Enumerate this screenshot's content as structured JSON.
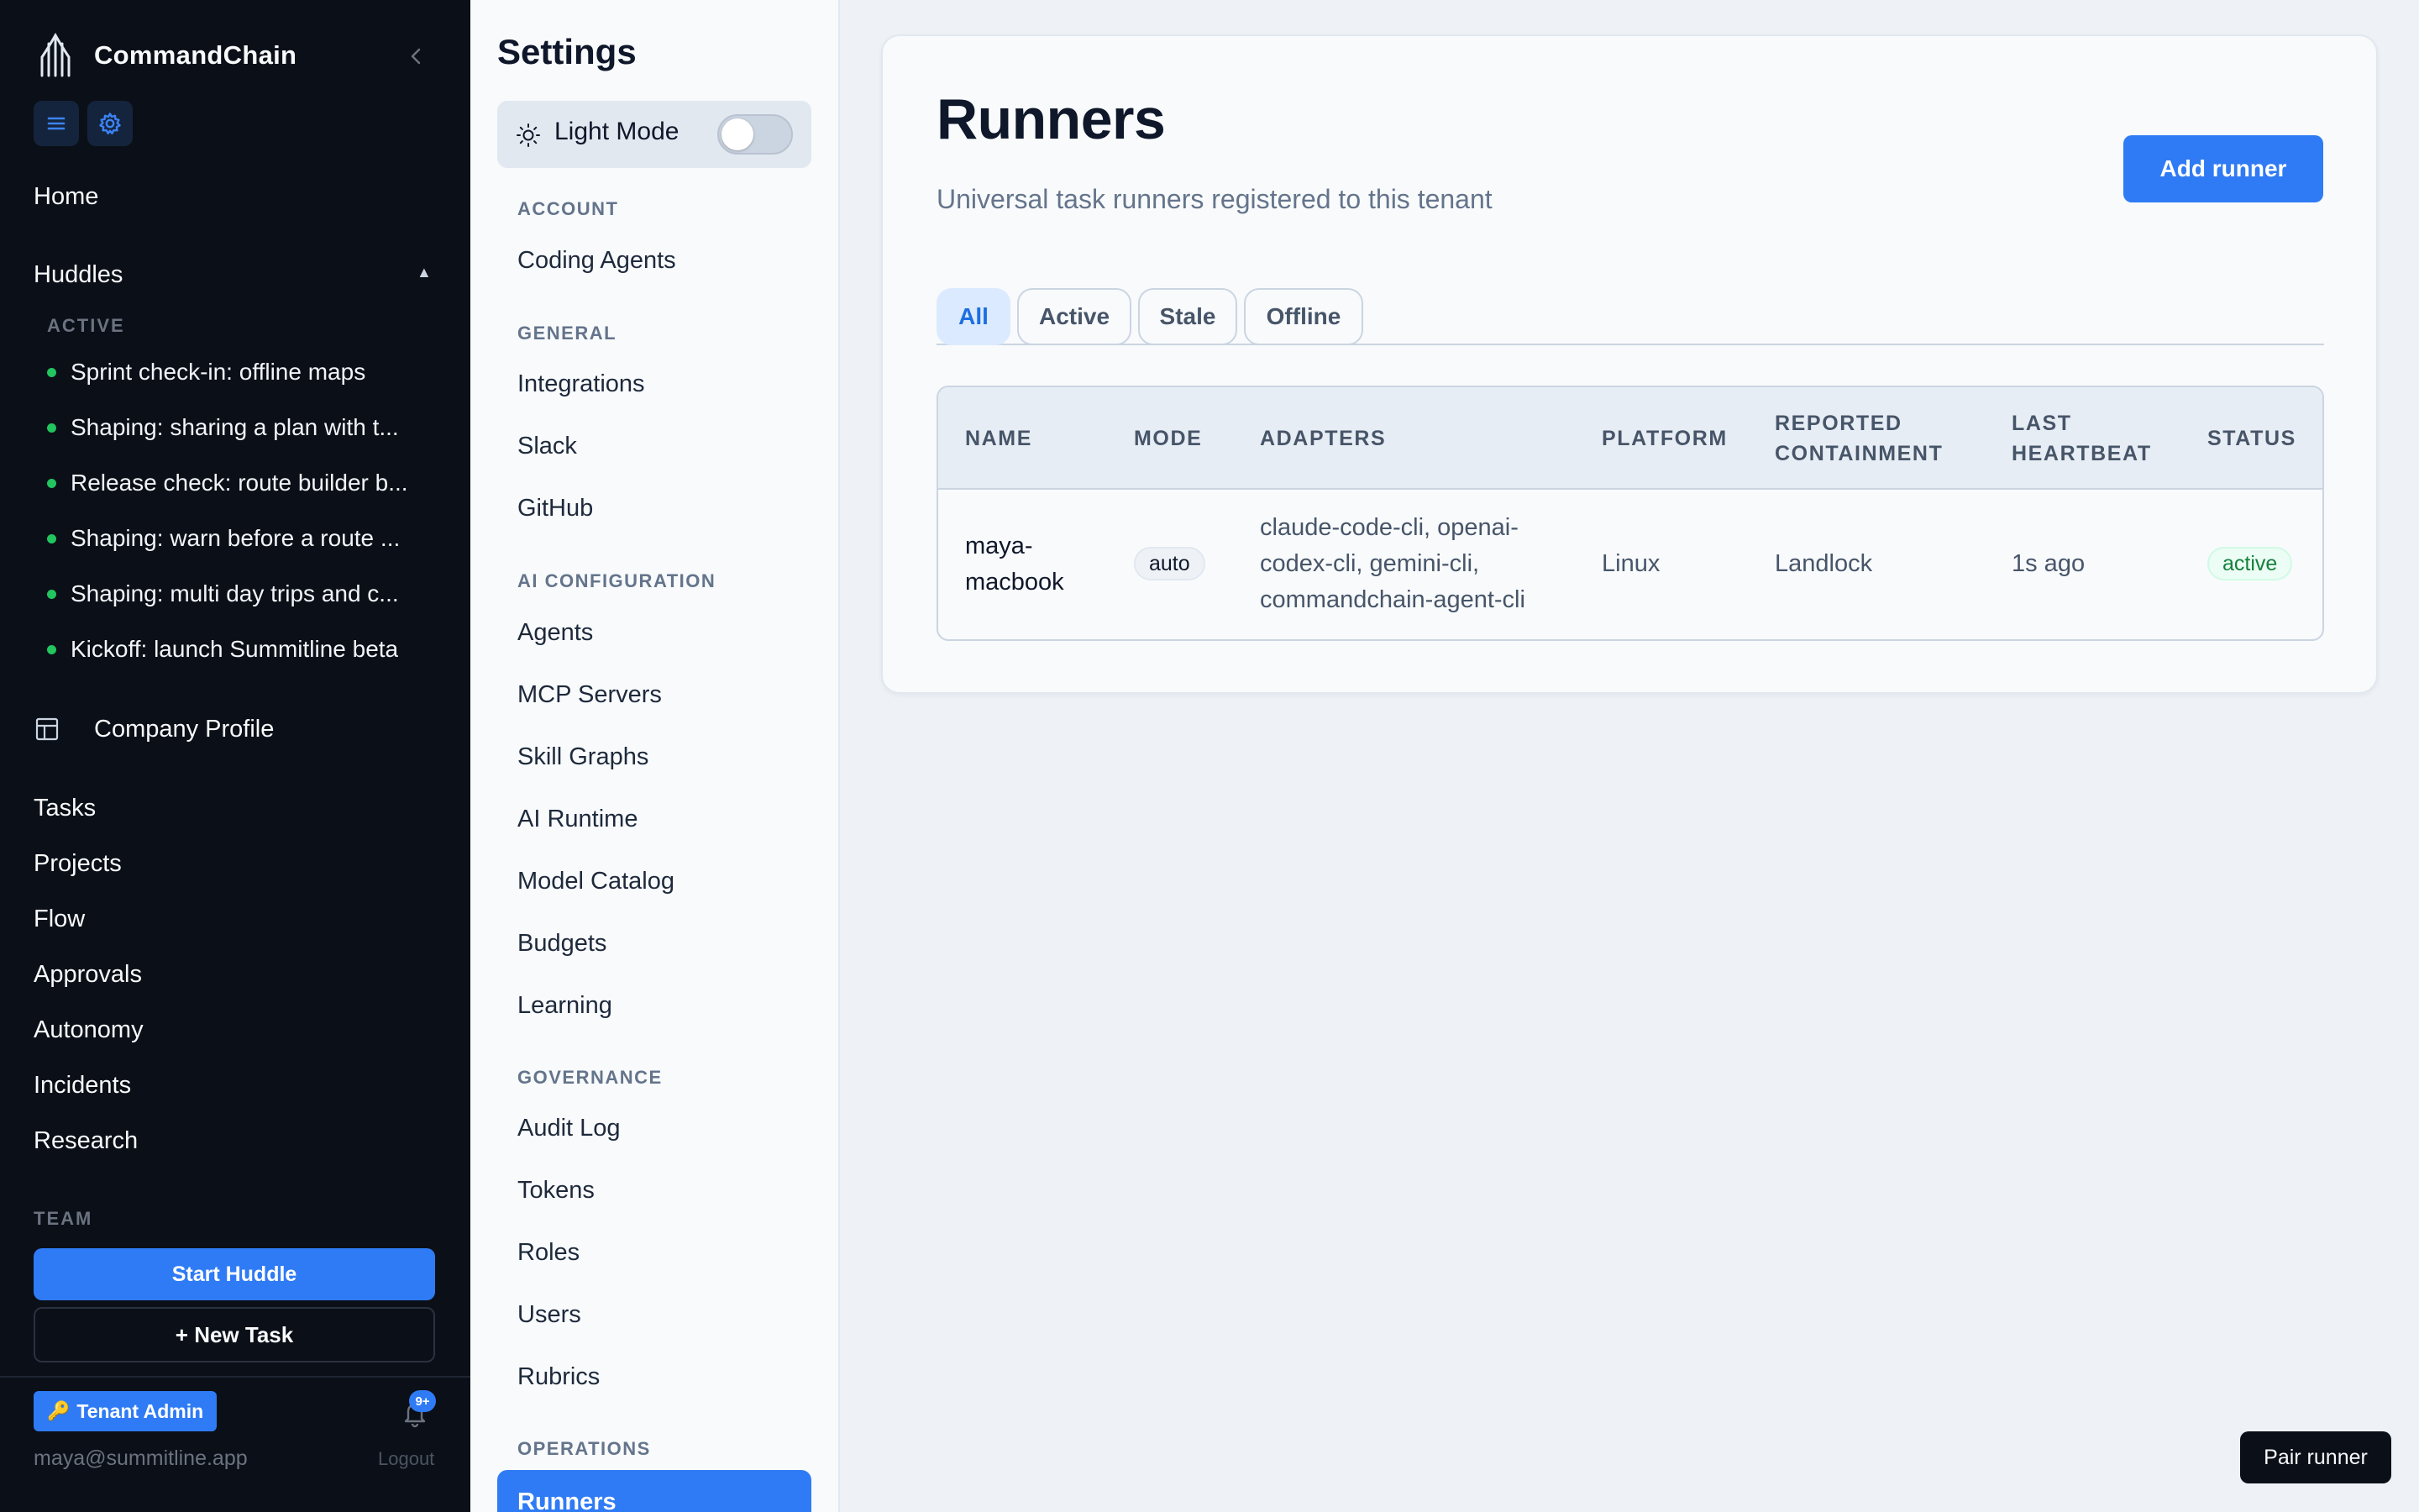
{
  "app": {
    "name": "CommandChain"
  },
  "sidebar": {
    "collapse_icon": "chevron-left-icon",
    "quick_icons": [
      "hamburger-icon",
      "gear-icon"
    ],
    "home": "Home",
    "huddles": {
      "label": "Huddles",
      "caret": "▲",
      "active_label": "ACTIVE",
      "items": [
        "Sprint check-in: offline maps",
        "Shaping: sharing a plan with t...",
        "Release check: route builder b...",
        "Shaping: warn before a route ...",
        "Shaping: multi day trips and c...",
        "Kickoff: launch Summitline beta"
      ]
    },
    "company_profile": "Company Profile",
    "nav": [
      "Tasks",
      "Projects",
      "Flow",
      "Approvals",
      "Autonomy",
      "Incidents",
      "Research"
    ],
    "team_label": "TEAM",
    "start_huddle": "Start Huddle",
    "new_task": "+ New Task",
    "tenant_badge": "Tenant Admin",
    "notification_count": "9+",
    "user_email": "maya@summitline.app",
    "logout": "Logout"
  },
  "settings": {
    "title": "Settings",
    "light_mode": {
      "label": "Light Mode",
      "enabled": false
    },
    "sections": {
      "account": {
        "label": "ACCOUNT",
        "items": [
          "Coding Agents"
        ]
      },
      "general": {
        "label": "GENERAL",
        "items": [
          "Integrations",
          "Slack",
          "GitHub"
        ]
      },
      "ai": {
        "label": "AI CONFIGURATION",
        "items": [
          "Agents",
          "MCP Servers",
          "Skill Graphs",
          "AI Runtime",
          "Model Catalog",
          "Budgets",
          "Learning"
        ]
      },
      "governance": {
        "label": "GOVERNANCE",
        "items": [
          "Audit Log",
          "Tokens",
          "Roles",
          "Users",
          "Rubrics"
        ]
      },
      "operations": {
        "label": "OPERATIONS",
        "active_item": "Runners"
      }
    }
  },
  "main": {
    "title": "Runners",
    "subtitle": "Universal task runners registered to this tenant",
    "add_button": "Add runner",
    "tabs": [
      "All",
      "Active",
      "Stale",
      "Offline"
    ],
    "active_tab": "All",
    "table": {
      "headers": {
        "name": "NAME",
        "mode": "MODE",
        "adapters": "ADAPTERS",
        "platform": "PLATFORM",
        "containment": [
          "REPORTED",
          "CONTAINMENT"
        ],
        "heartbeat": [
          "LAST",
          "HEARTBEAT"
        ],
        "status": "STATUS"
      },
      "rows": [
        {
          "name": [
            "maya-",
            "macbook"
          ],
          "mode": "auto",
          "adapters": [
            "claude-code-cli, openai-",
            "codex-cli, gemini-cli,",
            "commandchain-agent-cli"
          ],
          "platform": "Linux",
          "containment": "Landlock",
          "heartbeat": "1s ago",
          "status": "active"
        }
      ]
    }
  },
  "toast": {
    "label": "Pair runner"
  },
  "colors": {
    "accent": "#2f7bf5",
    "sidebar_bg": "#0b0f17",
    "status_active": "#15803d",
    "huddle_dot": "#22c55e"
  }
}
